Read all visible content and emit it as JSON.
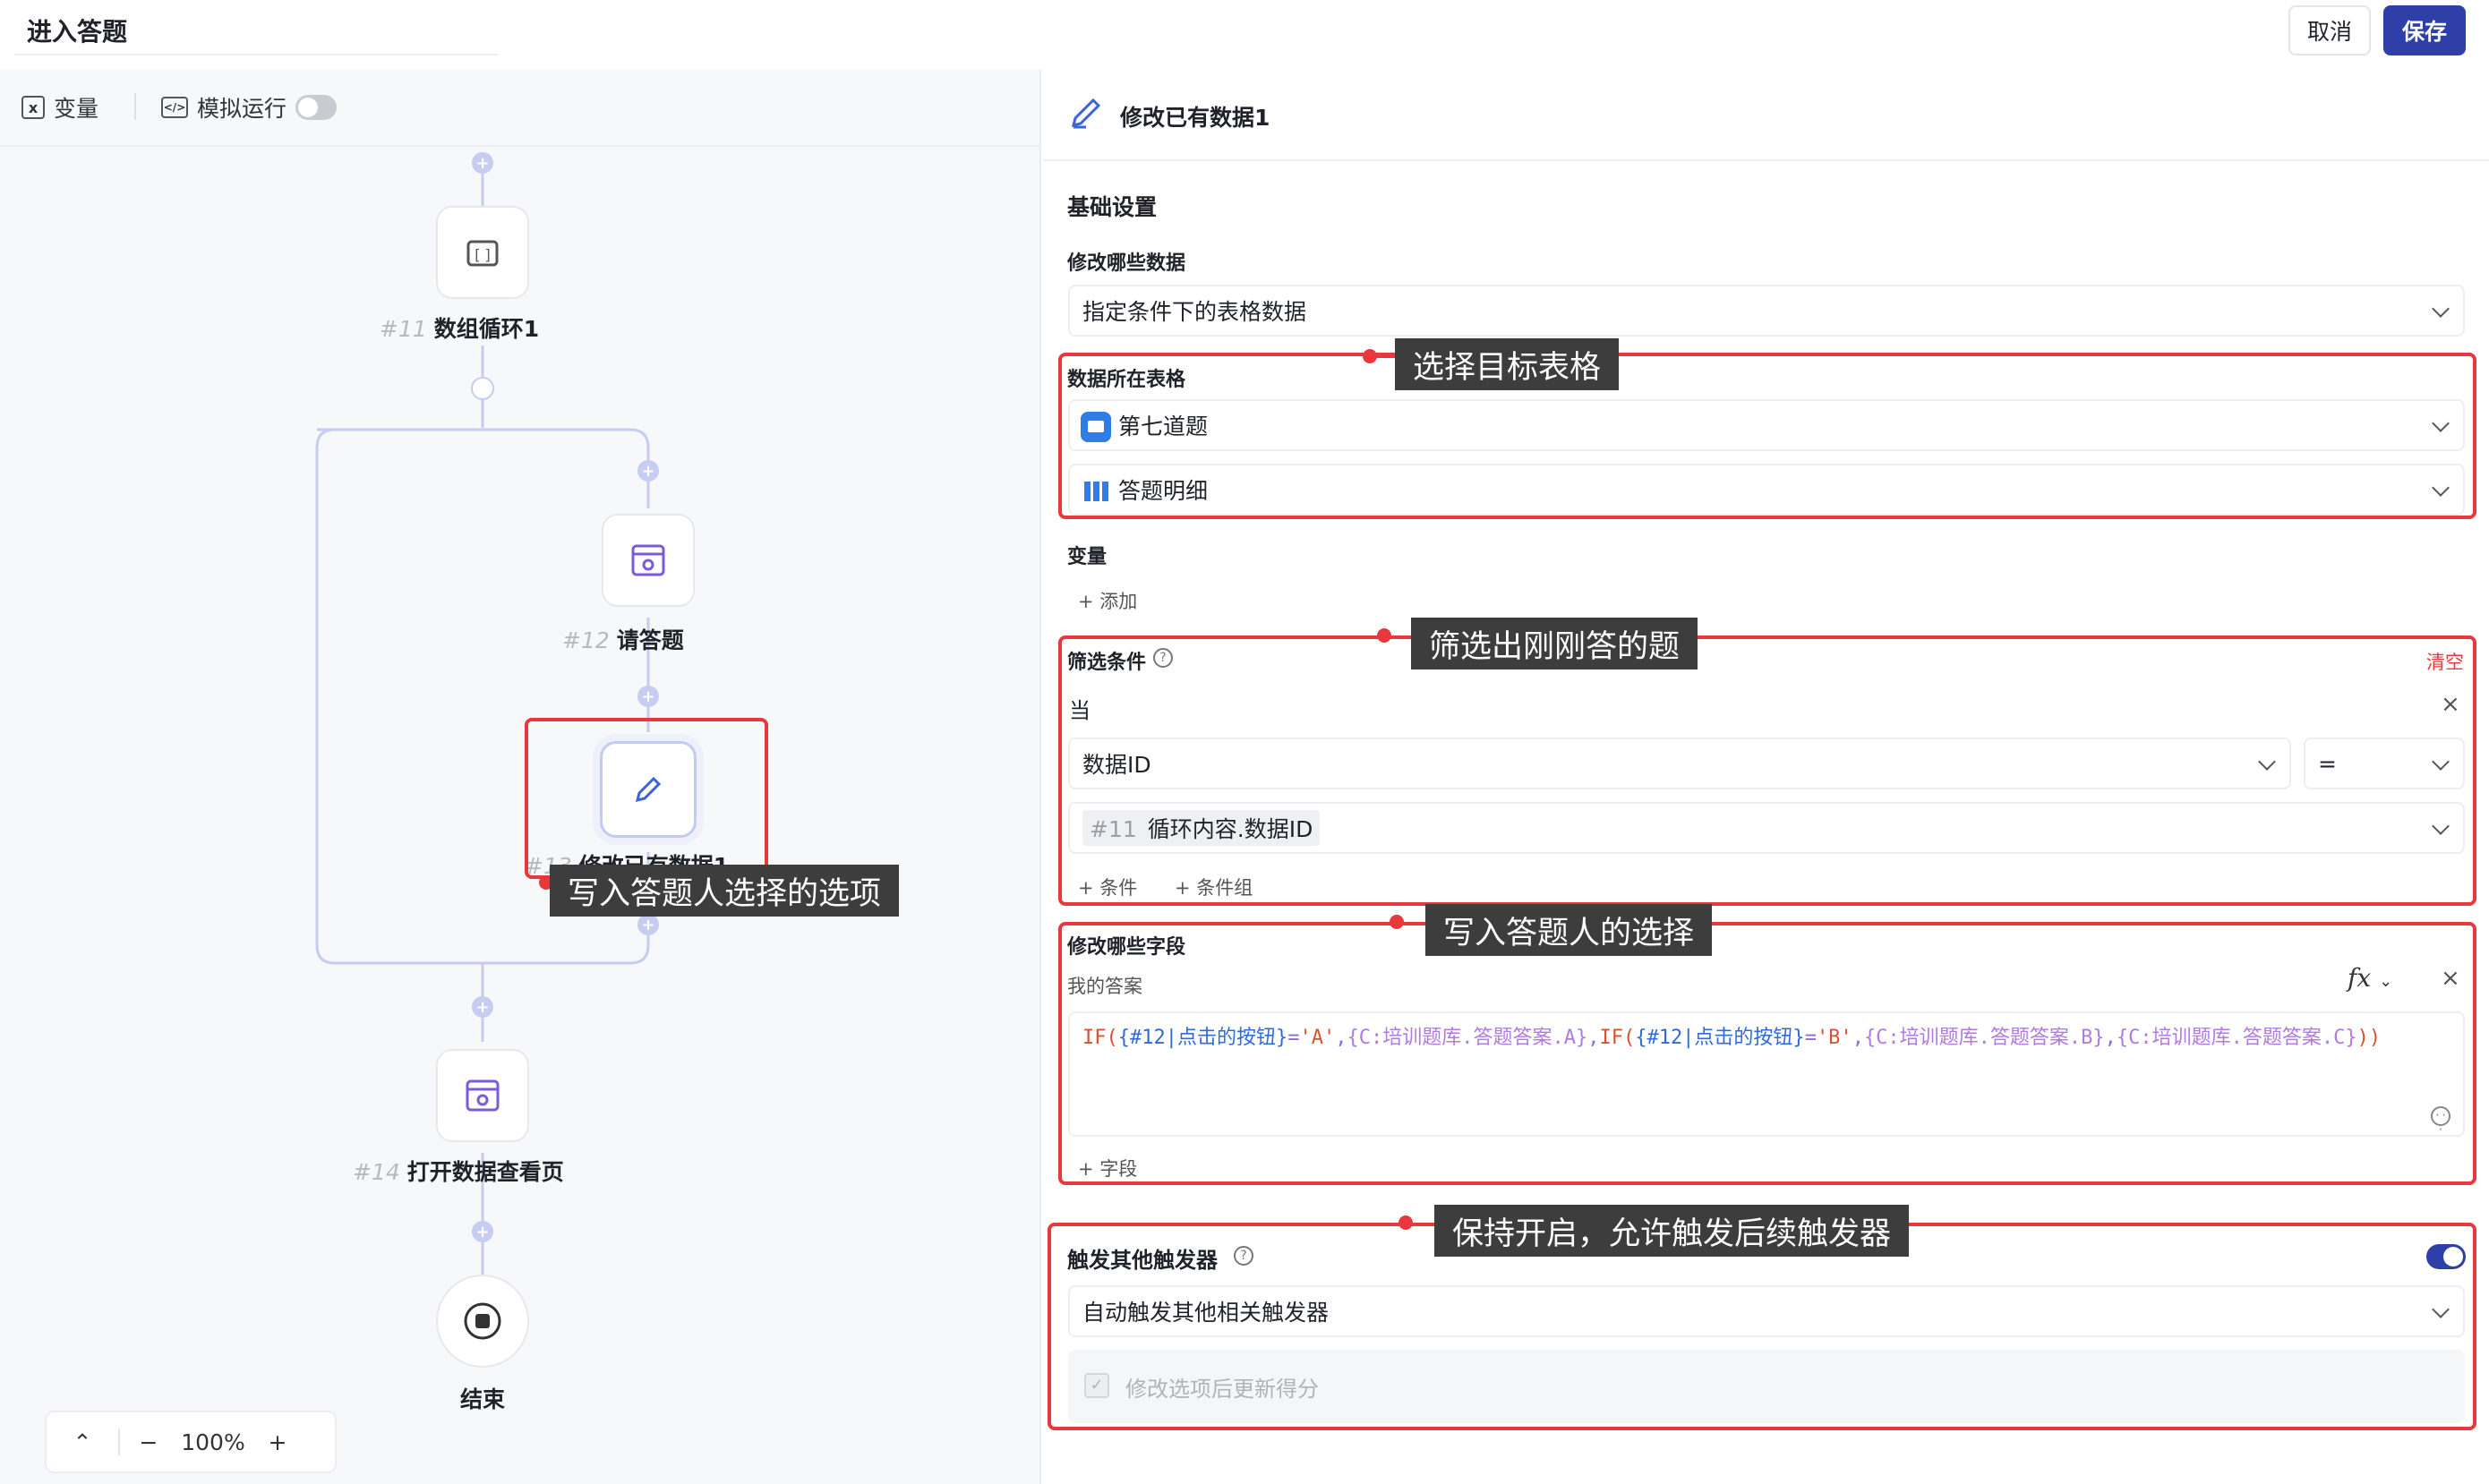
{
  "page": {
    "title": "进入答题"
  },
  "actions": {
    "cancel": "取消",
    "save": "保存"
  },
  "toolbar": {
    "variables": "变量",
    "simulate": "模拟运行"
  },
  "flow": {
    "nodes": [
      {
        "id": "#11",
        "label": "数组循环1"
      },
      {
        "id": "#12",
        "label": "请答题"
      },
      {
        "id": "#13",
        "label": "修改已有数据1"
      },
      {
        "id": "#14",
        "label": "打开数据查看页"
      },
      {
        "id": "",
        "label": "结束"
      }
    ],
    "zoom": "100%"
  },
  "panel": {
    "title": "修改已有数据1",
    "section_basic": "基础设置",
    "modify_which_data_label": "修改哪些数据",
    "modify_which_data_value": "指定条件下的表格数据",
    "table_label": "数据所在表格",
    "app_value": "第七道题",
    "table_value": "答题明细",
    "variables_label": "变量",
    "add_label": "添加",
    "filter_label": "筛选条件",
    "clear_label": "清空",
    "when_label": "当",
    "filter_field": "数据ID",
    "filter_op": "=",
    "filter_value_id": "#11",
    "filter_value": "循环内容.数据ID",
    "add_condition": "条件",
    "add_condition_group": "条件组",
    "fields_label": "修改哪些字段",
    "field_name": "我的答案",
    "fx_label": "fx",
    "formula": {
      "if1": "IF(",
      "ref1": "{#12|点击的按钮}",
      "eq1": "=",
      "str1": "'A'",
      "sep1": ",",
      "c1": "{C:培训题库.答题答案.A}",
      "sep2": ",",
      "if2": "IF(",
      "ref2": "{#12|点击的按钮}",
      "eq2": "=",
      "str2": "'B'",
      "sep3": ",",
      "c2": "{C:培训题库.答题答案.B}",
      "sep4": ",",
      "c3": "{C:培训题库.答题答案.C}",
      "close": "))"
    },
    "add_field": "字段",
    "trigger_label": "触发其他触发器",
    "trigger_value": "自动触发其他相关触发器",
    "trigger_enabled": true,
    "update_score_label": "修改选项后更新得分"
  },
  "annotations": {
    "a1": "选择目标表格",
    "a2": "筛选出刚刚答的题",
    "a3": "写入答题人的选择",
    "a4": "保持开启，允许触发后续触发器",
    "a5": "写入答题人选择的选项"
  },
  "colors": {
    "accent": "#2f3fa8",
    "annotation_red": "#e8383d",
    "callout_bg": "#3d3d3d"
  }
}
